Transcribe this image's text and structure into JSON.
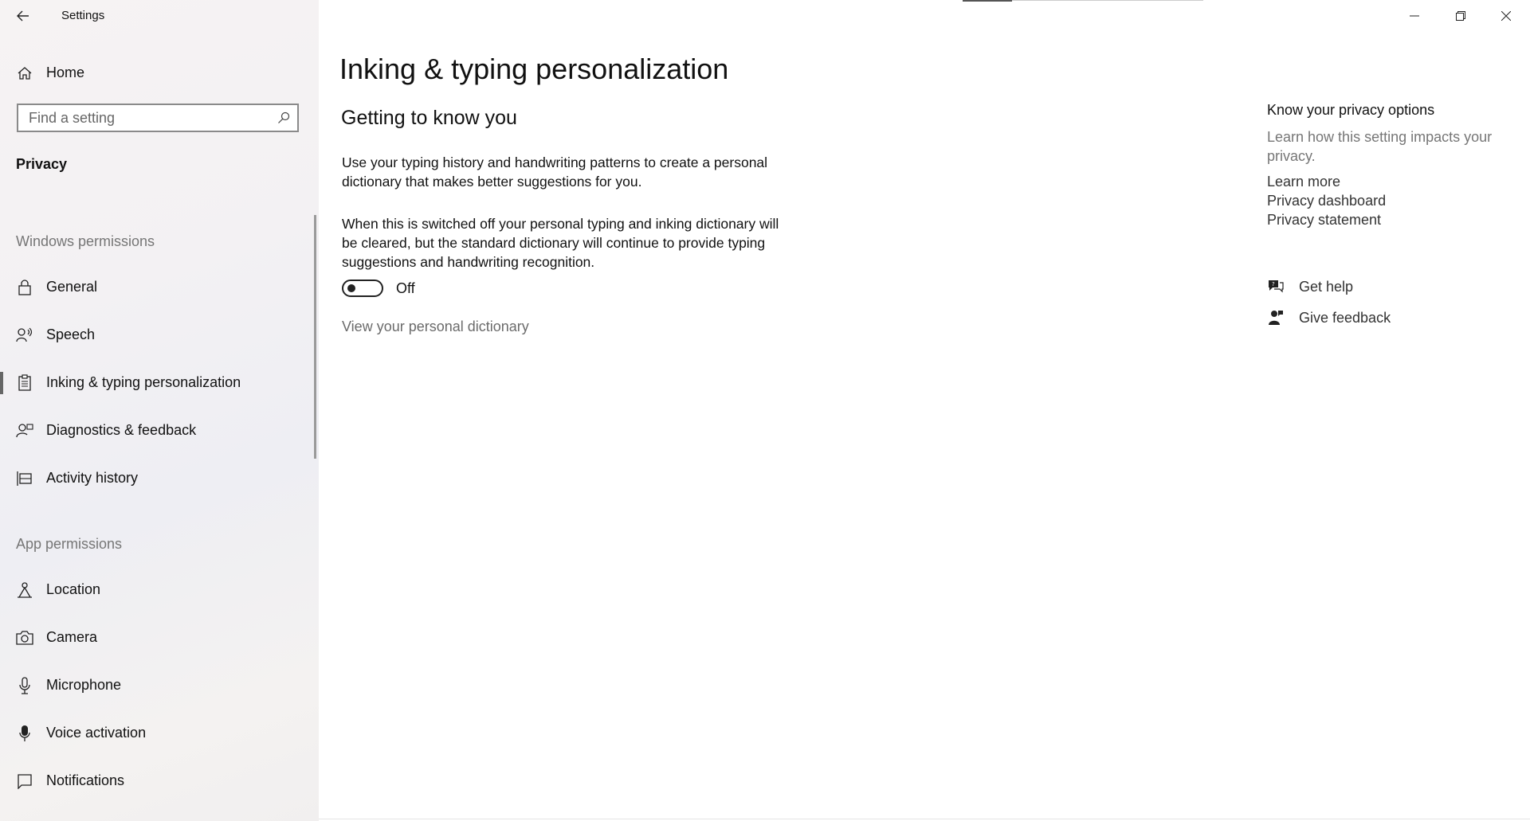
{
  "window": {
    "title": "Settings"
  },
  "sidebar": {
    "home_label": "Home",
    "search_placeholder": "Find a setting",
    "section_title": "Privacy",
    "groups": {
      "windows_permissions": "Windows permissions",
      "app_permissions": "App permissions"
    },
    "windows_items": [
      {
        "label": "General",
        "icon": "lock-icon"
      },
      {
        "label": "Speech",
        "icon": "speech-icon"
      },
      {
        "label": "Inking & typing personalization",
        "icon": "clipboard-icon",
        "selected": true
      },
      {
        "label": "Diagnostics & feedback",
        "icon": "diagnostics-icon"
      },
      {
        "label": "Activity history",
        "icon": "timeline-icon"
      }
    ],
    "app_items": [
      {
        "label": "Location",
        "icon": "location-icon"
      },
      {
        "label": "Camera",
        "icon": "camera-icon"
      },
      {
        "label": "Microphone",
        "icon": "microphone-icon"
      },
      {
        "label": "Voice activation",
        "icon": "voice-activation-icon"
      },
      {
        "label": "Notifications",
        "icon": "notifications-icon"
      }
    ]
  },
  "main": {
    "title": "Inking & typing personalization",
    "subtitle": "Getting to know you",
    "description": "Use your typing history and handwriting patterns to create a personal dictionary that makes better suggestions for you.",
    "note": "When this is switched off your personal typing and inking dictionary will be cleared, but the standard dictionary will continue to provide typing suggestions and handwriting recognition.",
    "toggle": {
      "state": "Off",
      "on": false
    },
    "dictionary_link": "View your personal dictionary"
  },
  "side_panel": {
    "title": "Know your privacy options",
    "description": "Learn how this setting impacts your privacy.",
    "links": [
      "Learn more",
      "Privacy dashboard",
      "Privacy statement"
    ],
    "get_help": "Get help",
    "give_feedback": "Give feedback"
  }
}
